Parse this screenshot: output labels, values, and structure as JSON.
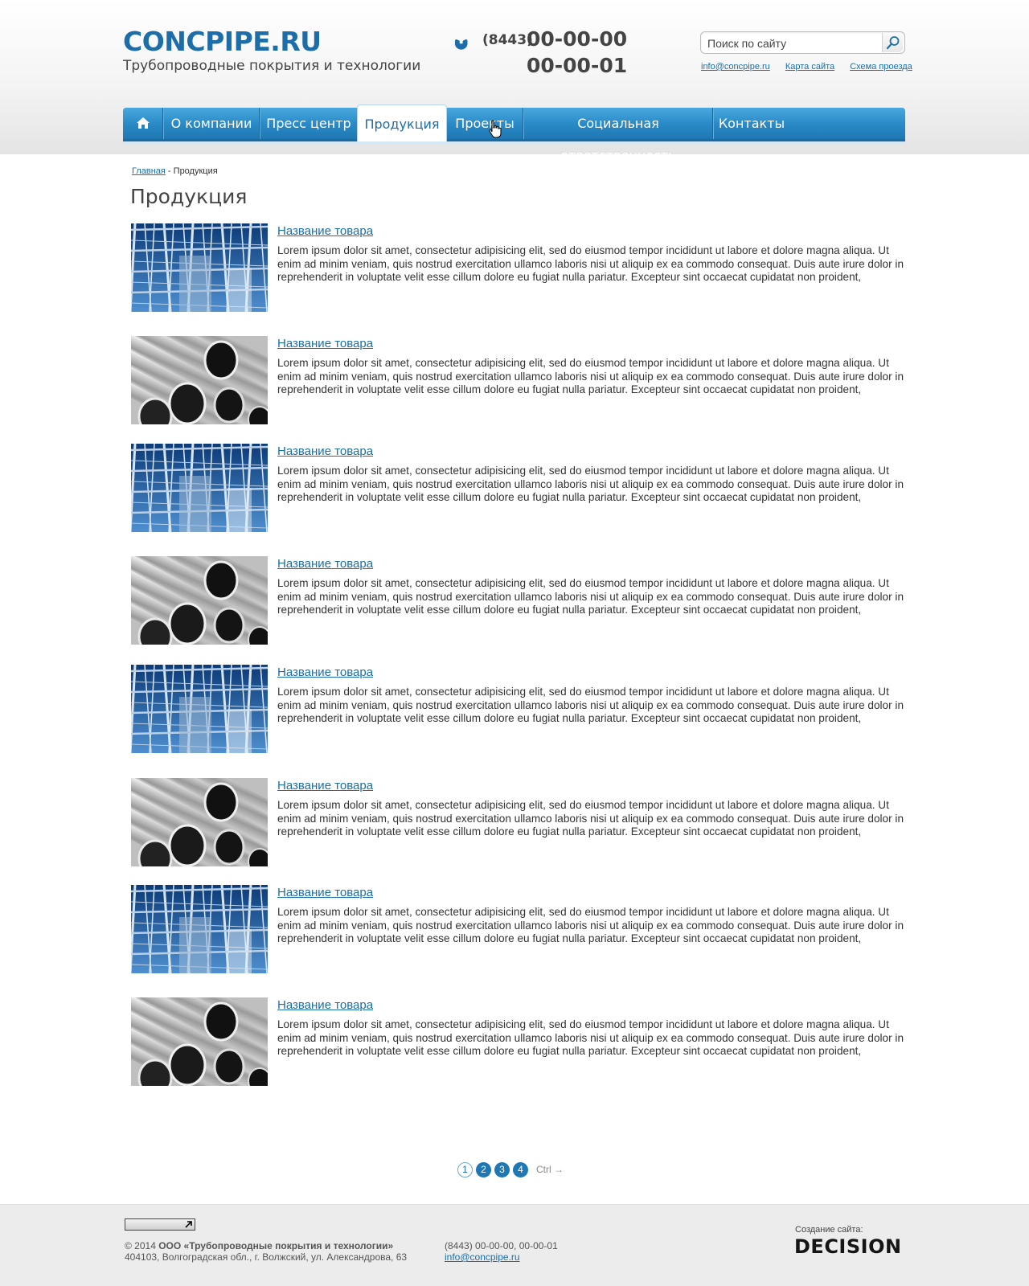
{
  "header": {
    "logo": "CONCPIPE.RU",
    "tagline": "Трубопроводные покрытия и технологии",
    "phone_code": "(8443)",
    "phone_1": "00-00-00",
    "phone_2": "00-00-01",
    "search_placeholder": "Поиск по сайту",
    "links": [
      "info@concpipe.ru",
      "Карта сайта",
      "Схема проезда"
    ]
  },
  "nav": {
    "items": [
      "О компании",
      "Пресс центр",
      "Продукция",
      "Проекты",
      "Социальная ответственность",
      "Контакты"
    ],
    "active": "Продукция"
  },
  "breadcrumb": {
    "home": "Главная",
    "separator": " - ",
    "current": "Продукция"
  },
  "page_title": "Продукция",
  "products": [
    {
      "name": "Название товара",
      "image": "plant-structure",
      "desc": "Lorem ipsum dolor sit amet, consectetur adipisicing elit, sed do eiusmod tempor incididunt ut labore et dolore magna aliqua. Ut enim ad minim veniam, quis nostrud exercitation ullamco laboris nisi ut aliquip ex ea commodo consequat. Duis aute irure dolor in reprehenderit in voluptate velit esse cillum dolore eu fugiat nulla pariatur. Excepteur sint occaecat cupidatat non proident,"
    },
    {
      "name": "Название товара",
      "image": "steel-pipes",
      "desc": "Lorem ipsum dolor sit amet, consectetur adipisicing elit, sed do eiusmod tempor incididunt ut labore et dolore magna aliqua. Ut enim ad minim veniam, quis nostrud exercitation ullamco laboris nisi ut aliquip ex ea commodo consequat. Duis aute irure dolor in reprehenderit in voluptate velit esse cillum dolore eu fugiat nulla pariatur. Excepteur sint occaecat cupidatat non proident,"
    },
    {
      "name": "Название товара",
      "image": "plant-structure",
      "desc": "Lorem ipsum dolor sit amet, consectetur adipisicing elit, sed do eiusmod tempor incididunt ut labore et dolore magna aliqua. Ut enim ad minim veniam, quis nostrud exercitation ullamco laboris nisi ut aliquip ex ea commodo consequat. Duis aute irure dolor in reprehenderit in voluptate velit esse cillum dolore eu fugiat nulla pariatur. Excepteur sint occaecat cupidatat non proident,"
    },
    {
      "name": "Название товара",
      "image": "steel-pipes",
      "desc": "Lorem ipsum dolor sit amet, consectetur adipisicing elit, sed do eiusmod tempor incididunt ut labore et dolore magna aliqua. Ut enim ad minim veniam, quis nostrud exercitation ullamco laboris nisi ut aliquip ex ea commodo consequat. Duis aute irure dolor in reprehenderit in voluptate velit esse cillum dolore eu fugiat nulla pariatur. Excepteur sint occaecat cupidatat non proident,"
    },
    {
      "name": "Название товара",
      "image": "plant-structure",
      "desc": "Lorem ipsum dolor sit amet, consectetur adipisicing elit, sed do eiusmod tempor incididunt ut labore et dolore magna aliqua. Ut enim ad minim veniam, quis nostrud exercitation ullamco laboris nisi ut aliquip ex ea commodo consequat. Duis aute irure dolor in reprehenderit in voluptate velit esse cillum dolore eu fugiat nulla pariatur. Excepteur sint occaecat cupidatat non proident,"
    },
    {
      "name": "Название товара",
      "image": "steel-pipes",
      "desc": "Lorem ipsum dolor sit amet, consectetur adipisicing elit, sed do eiusmod tempor incididunt ut labore et dolore magna aliqua. Ut enim ad minim veniam, quis nostrud exercitation ullamco laboris nisi ut aliquip ex ea commodo consequat. Duis aute irure dolor in reprehenderit in voluptate velit esse cillum dolore eu fugiat nulla pariatur. Excepteur sint occaecat cupidatat non proident,"
    },
    {
      "name": "Название товара",
      "image": "plant-structure",
      "desc": "Lorem ipsum dolor sit amet, consectetur adipisicing elit, sed do eiusmod tempor incididunt ut labore et dolore magna aliqua. Ut enim ad minim veniam, quis nostrud exercitation ullamco laboris nisi ut aliquip ex ea commodo consequat. Duis aute irure dolor in reprehenderit in voluptate velit esse cillum dolore eu fugiat nulla pariatur. Excepteur sint occaecat cupidatat non proident,"
    },
    {
      "name": "Название товара",
      "image": "steel-pipes",
      "desc": "Lorem ipsum dolor sit amet, consectetur adipisicing elit, sed do eiusmod tempor incididunt ut labore et dolore magna aliqua. Ut enim ad minim veniam, quis nostrud exercitation ullamco laboris nisi ut aliquip ex ea commodo consequat. Duis aute irure dolor in reprehenderit in voluptate velit esse cillum dolore eu fugiat nulla pariatur. Excepteur sint occaecat cupidatat non proident,"
    }
  ],
  "pagination": {
    "pages": [
      "1",
      "2",
      "3",
      "4"
    ],
    "current": "1",
    "next_hint": "Ctrl →"
  },
  "footer": {
    "copyright_prefix": "© 2014 ",
    "company": "ООО «Трубопроводные покрытия и технологии»",
    "address": "404103, Волгоградская обл., г. Волжский, ул. Александрова, 63",
    "phones": "(8443) 00-00-00, 00-00-01",
    "email": "info@concpipe.ru",
    "creator_label": "Создание сайта:",
    "creator_name": "DECISION"
  },
  "colors": {
    "brand": "#1d6ea8",
    "nav": "#2a8bc8",
    "link": "#1a6fa5"
  },
  "icons": [
    "phone-icon",
    "search-icon",
    "home-icon",
    "hand-cursor-icon",
    "external-arrow-icon"
  ]
}
